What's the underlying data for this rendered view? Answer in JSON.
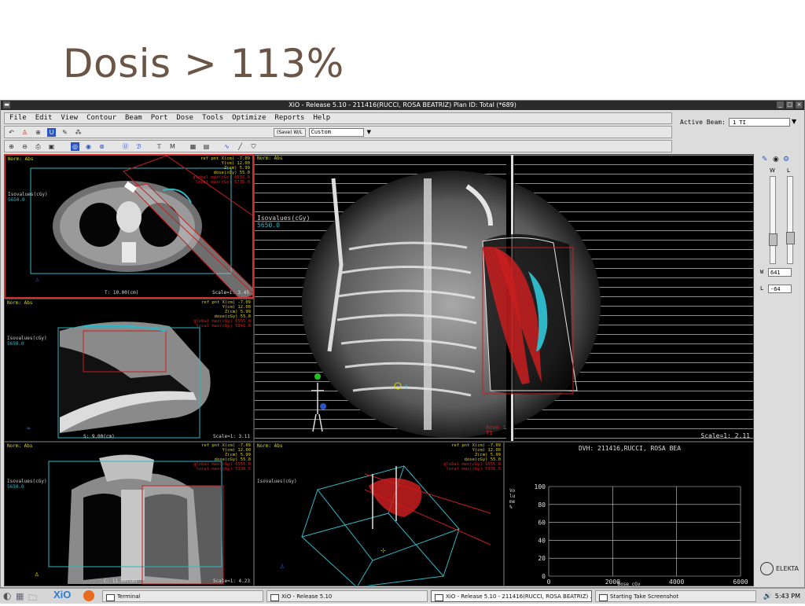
{
  "slide": {
    "title": "Dosis > 113%"
  },
  "window": {
    "title": "XiO - Release 5.10 - 211416(RUCCI, ROSA BEATRIZ) Plan ID: Total (*689)",
    "menu": [
      "File",
      "Edit",
      "View",
      "Contour",
      "Beam",
      "Port",
      "Dose",
      "Tools",
      "Optimize",
      "Reports",
      "Help"
    ],
    "window_level_label": "(Save) W/L",
    "preset_value": "Custom",
    "active_beam_label": "Active Beam:",
    "active_beam_value": "1 TI"
  },
  "viewports": {
    "axial": {
      "norm": "Norm: Abs",
      "iso_label": "Isovalues(cGy)",
      "iso_value": "5650.0",
      "ref_lines": [
        "ref pnt X(cm) -7.09",
        "Y(cm) 12.00",
        "Z(cm) 5.99",
        "dose(cGy) 55.0"
      ],
      "global_max": "global max(cGy) 6555.0",
      "local_max": "local max(cGy) 5735.0",
      "slice": "T:  10.00(cm)",
      "scale": "Scale=1: 3.45"
    },
    "sagittal": {
      "norm": "Norm: Abs",
      "iso_label": "Isovalues(cGy)",
      "iso_value": "5650.0",
      "ref_lines": [
        "ref pnt X(cm) -7.09",
        "Y(cm) 12.00",
        "Z(cm) 5.99",
        "dose(cGy) 55.0"
      ],
      "global_max": "global max(cGy) 6555.0",
      "local_max": "local max(cGy) 5841.0",
      "slice": "S:   9.00(cm)",
      "scale": "Scale=1: 3.11"
    },
    "bev": {
      "norm": "Norm: Abs",
      "iso_label": "Isovalues(cGy)",
      "iso_value": "5650.0",
      "beam_label": "Beam 1",
      "beam_sub": "TI",
      "scale": "Scale=1: 2.11"
    },
    "coronal": {
      "norm": "Norm: Abs",
      "iso_label": "Isovalues(cGy)",
      "iso_value": "5650.0",
      "ref_lines": [
        "ref pnt X(cm) -7.09",
        "Y(cm) 12.00",
        "Z(cm) 5.99",
        "dose(cGy) 55.0"
      ],
      "global_max": "global max(cGy) 6555.0",
      "local_max": "local max(cGy) 5330.5",
      "slice": "C:  11.00(cm)",
      "scale": "Scale=1: 4.23"
    },
    "three_d": {
      "norm": "Norm: Abs",
      "iso_label": "Isovalues(cGy)",
      "ref_lines": [
        "ref pnt X(cm) -7.09",
        "Y(cm) 12.00",
        "Z(cm) 5.99",
        "dose(cGy) 55.0"
      ],
      "global_max": "global max(cGy) 6555.0",
      "local_max": "local max(cGy) 5936.5"
    },
    "dvh": {
      "title": "DVH: 211416,RUCCI, ROSA BEA",
      "ylabel": "Volume %",
      "xlabel": "Dose cGy"
    }
  },
  "sidebar": {
    "w_label": "W",
    "l_label": "L",
    "w_value": "641",
    "l_value": "-64",
    "brand": "ELEKTA"
  },
  "taskbar": {
    "xio": "XiO",
    "tasks": [
      "Terminal",
      "XiO - Release 5.10",
      "XiO - Release 5.10 - 211416(RUCCI, ROSA BEATRIZ) ...",
      "Starting Take Screenshot"
    ],
    "clock": "5:43 PM"
  },
  "chart_data": {
    "type": "line",
    "title": "DVH: 211416,RUCCI, ROSA BEA",
    "xlabel": "Dose cGy",
    "ylabel": "Volume %",
    "xlim": [
      0,
      6000
    ],
    "ylim": [
      0,
      100
    ],
    "xticks": [
      0,
      2000,
      4000,
      6000
    ],
    "yticks": [
      0,
      20,
      40,
      60,
      80,
      100
    ],
    "grid": true,
    "series": []
  },
  "colors": {
    "dose_red": "#c81e1e",
    "contour_cyan": "#2fb7c6",
    "label_yellow": "#d8d800"
  }
}
